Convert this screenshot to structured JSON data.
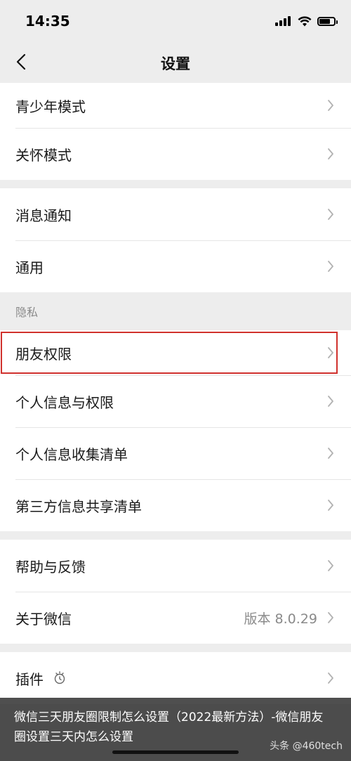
{
  "status_bar": {
    "time": "14:35",
    "battery_level": 0.85
  },
  "nav": {
    "title": "设置"
  },
  "groups": [
    {
      "rows": [
        {
          "label": "青少年模式"
        },
        {
          "label": "关怀模式"
        }
      ]
    },
    {
      "rows": [
        {
          "label": "消息通知"
        },
        {
          "label": "通用"
        }
      ]
    },
    {
      "section_header": "隐私",
      "rows": [
        {
          "label": "朋友权限",
          "highlighted": true
        },
        {
          "label": "个人信息与权限"
        },
        {
          "label": "个人信息收集清单"
        },
        {
          "label": "第三方信息共享清单"
        }
      ]
    },
    {
      "rows": [
        {
          "label": "帮助与反馈"
        },
        {
          "label": "关于微信",
          "value": "版本 8.0.29"
        }
      ]
    },
    {
      "rows": [
        {
          "label": "插件",
          "icon": "plugin-bulb-icon"
        }
      ]
    }
  ],
  "caption": {
    "text": "微信三天朋友圈限制怎么设置（2022最新方法）-微信朋友圈设置三天内怎么设置",
    "source": "头条 @460tech"
  },
  "colors": {
    "background": "#ededed",
    "highlight": "#d0312d",
    "chevron": "#b2b2b2"
  }
}
